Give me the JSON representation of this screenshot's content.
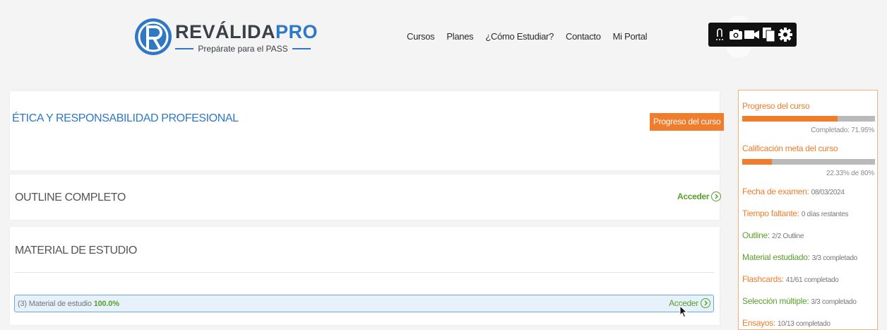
{
  "header": {
    "logo": {
      "brand_main": "REVÁLIDA",
      "brand_accent": "PRO",
      "tagline": "Prepárate para el PASS"
    },
    "nav": [
      {
        "label": "Cursos"
      },
      {
        "label": "Planes"
      },
      {
        "label": "¿Cómo Estudiar?"
      },
      {
        "label": "Contacto"
      },
      {
        "label": "Mi Portal"
      }
    ],
    "recorder_toolbar": {
      "icons": [
        "attachment-icon",
        "camera-icon",
        "video-icon",
        "copy-icon",
        "gear-icon"
      ]
    }
  },
  "course": {
    "title": "ÉTICA Y RESPONSABILIDAD PROFESIONAL",
    "progress_button": "Progreso del curso"
  },
  "sections": {
    "outline": {
      "title": "OUTLINE COMPLETO",
      "action": "Acceder"
    },
    "material": {
      "title": "MATERIAL DE ESTUDIO",
      "row_label": "(3) Material de estudio",
      "row_percent": "100.0%",
      "row_action": "Acceder"
    }
  },
  "sidebar": {
    "progress": {
      "label": "Progreso del curso",
      "note": "Completado: 71.95%",
      "value": 71.95
    },
    "goal": {
      "label": "Calificación meta del curso",
      "note": "22.33% de 80%",
      "value": 22.33,
      "target": 80
    },
    "stats": [
      {
        "key": "Fecha de examen:",
        "value": "08/03/2024",
        "color": "orange"
      },
      {
        "key": "Tiempo faltante:",
        "value": "0 días restantes",
        "color": "orange"
      },
      {
        "key": "Outline:",
        "value": "2/2 Outline",
        "color": "green"
      },
      {
        "key": "Material estudiado:",
        "value": "3/3 completado",
        "color": "green"
      },
      {
        "key": "Flashcards:",
        "value": "41/61 completado",
        "color": "orange"
      },
      {
        "key": "Selección múltiple:",
        "value": "3/3 completado",
        "color": "green"
      },
      {
        "key": "Ensayos:",
        "value": "10/13 completado",
        "color": "orange"
      }
    ]
  },
  "colors": {
    "brand_blue": "#2f78c4",
    "accent_orange": "#ef7d2c",
    "success_green": "#5aa02c"
  }
}
